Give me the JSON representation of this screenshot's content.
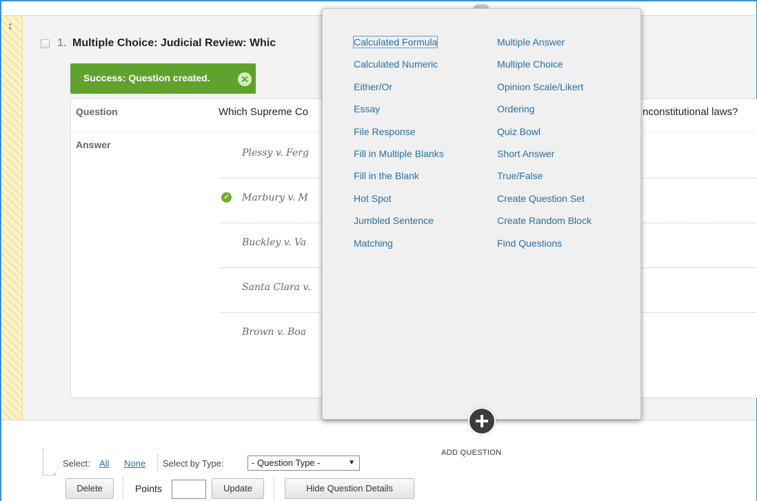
{
  "question": {
    "number": "1.",
    "title": "Multiple Choice: Judicial Review: Whic",
    "success_message": "Success: Question created.",
    "question_label": "Question",
    "question_text": "Which Supreme Co",
    "question_text_tail": "nconstitutional laws?",
    "answer_label": "Answer",
    "answers": [
      {
        "text": "Plessy v. Ferg",
        "correct": false
      },
      {
        "text": "Marbury v. M",
        "correct": true
      },
      {
        "text": "Buckley v. Va",
        "correct": false
      },
      {
        "text": "Santa Clara v.",
        "correct": false
      },
      {
        "text": "Brown v. Boa",
        "correct": false
      }
    ]
  },
  "menu": {
    "left": [
      "Calculated Formula",
      "Calculated Numeric",
      "Either/Or",
      "Essay",
      "File Response",
      "Fill in Multiple Blanks",
      "Fill in the Blank",
      "Hot Spot",
      "Jumbled Sentence",
      "Matching"
    ],
    "right": [
      "Multiple Answer",
      "Multiple Choice",
      "Opinion Scale/Likert",
      "Ordering",
      "Quiz Bowl",
      "Short Answer",
      "True/False",
      "Create Question Set",
      "Create Random Block",
      "Find Questions"
    ],
    "add_question_label": "ADD QUESTION"
  },
  "toolbar": {
    "select_label": "Select:",
    "all_link": "All",
    "none_link": "None",
    "select_by_type_label": "Select by Type:",
    "type_select_value": "- Question Type -",
    "delete_button": "Delete",
    "points_label": "Points",
    "points_value": "",
    "update_button": "Update",
    "hide_details_button": "Hide Question Details"
  },
  "colors": {
    "accent": "#3a8fd1",
    "success": "#5fa22e",
    "link": "#2a6fa3"
  }
}
